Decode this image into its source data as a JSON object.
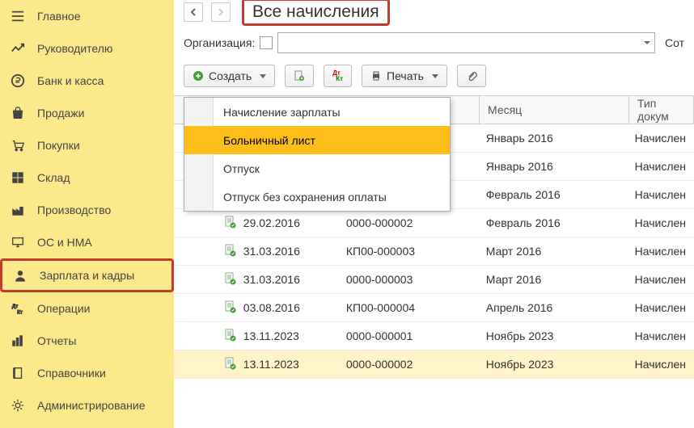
{
  "sidebar": {
    "items": [
      {
        "label": "Главное"
      },
      {
        "label": "Руководителю"
      },
      {
        "label": "Банк и касса"
      },
      {
        "label": "Продажи"
      },
      {
        "label": "Покупки"
      },
      {
        "label": "Склад"
      },
      {
        "label": "Производство"
      },
      {
        "label": "ОС и НМА"
      },
      {
        "label": "Зарплата и кадры"
      },
      {
        "label": "Операции"
      },
      {
        "label": "Отчеты"
      },
      {
        "label": "Справочники"
      },
      {
        "label": "Администрирование"
      }
    ]
  },
  "header": {
    "title": "Все начисления",
    "filter_label": "Организация:",
    "filter_right": "Сот"
  },
  "toolbar": {
    "create_label": "Создать",
    "print_label": "Печать"
  },
  "dropdown": {
    "items": [
      {
        "label": "Начисление зарплаты"
      },
      {
        "label": "Больничный лист"
      },
      {
        "label": "Отпуск"
      },
      {
        "label": "Отпуск без сохранения оплаты"
      }
    ]
  },
  "table": {
    "columns": {
      "c4": "Месяц",
      "c5": "Тип докум"
    },
    "rows": [
      {
        "date": "",
        "num": "",
        "month": "Январь 2016",
        "type": "Начислен"
      },
      {
        "date": "",
        "num": "",
        "month": "Январь 2016",
        "type": "Начислен"
      },
      {
        "date": "",
        "num": "",
        "month": "Февраль 2016",
        "type": "Начислен"
      },
      {
        "date": "29.02.2016",
        "num": "0000-000002",
        "month": "Февраль 2016",
        "type": "Начислен"
      },
      {
        "date": "31.03.2016",
        "num": "КП00-000003",
        "month": "Март 2016",
        "type": "Начислен"
      },
      {
        "date": "31.03.2016",
        "num": "0000-000003",
        "month": "Март 2016",
        "type": "Начислен"
      },
      {
        "date": "03.08.2016",
        "num": "КП00-000004",
        "month": "Апрель 2016",
        "type": "Начислен"
      },
      {
        "date": "13.11.2023",
        "num": "0000-000001",
        "month": "Ноябрь 2023",
        "type": "Начислен"
      },
      {
        "date": "13.11.2023",
        "num": "0000-000002",
        "month": "Ноябрь 2023",
        "type": "Начислен"
      }
    ]
  }
}
